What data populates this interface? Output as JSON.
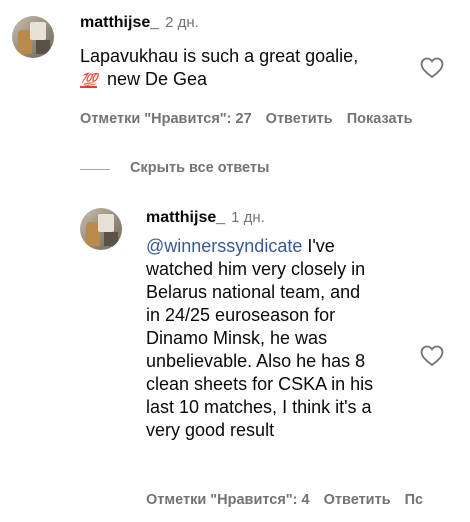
{
  "comment1": {
    "username": "matthijse_",
    "time": "2 дн.",
    "line1": "Lapavukhau is such a great goalie,",
    "emoji": "💯",
    "line2": "new De Gea",
    "likes": "Отметки \"Нравится\": 27",
    "reply": "Ответить",
    "translate": "Показать"
  },
  "thread": {
    "hide_replies": "Скрыть все ответы"
  },
  "comment2": {
    "username": "matthijse_",
    "time": "1 дн.",
    "mention": "@winnerssyndicate",
    "lines": [
      " I've",
      "watched him very closely in",
      "Belarus national team, and",
      "in 24/25 euroseason for",
      "Dinamo Minsk, he was",
      "unbelievable. Also he has 8",
      "clean sheets for CSKA in his",
      "last 10 matches, I think it's a",
      "very good result"
    ],
    "likes": "Отметки \"Нравится\": 4",
    "reply": "Ответить",
    "translate": "Пс"
  },
  "icons": {
    "like": "heart-outline-icon"
  },
  "colors": {
    "text": "#0a0a0a",
    "secondary": "#737373",
    "link": "#385898"
  }
}
